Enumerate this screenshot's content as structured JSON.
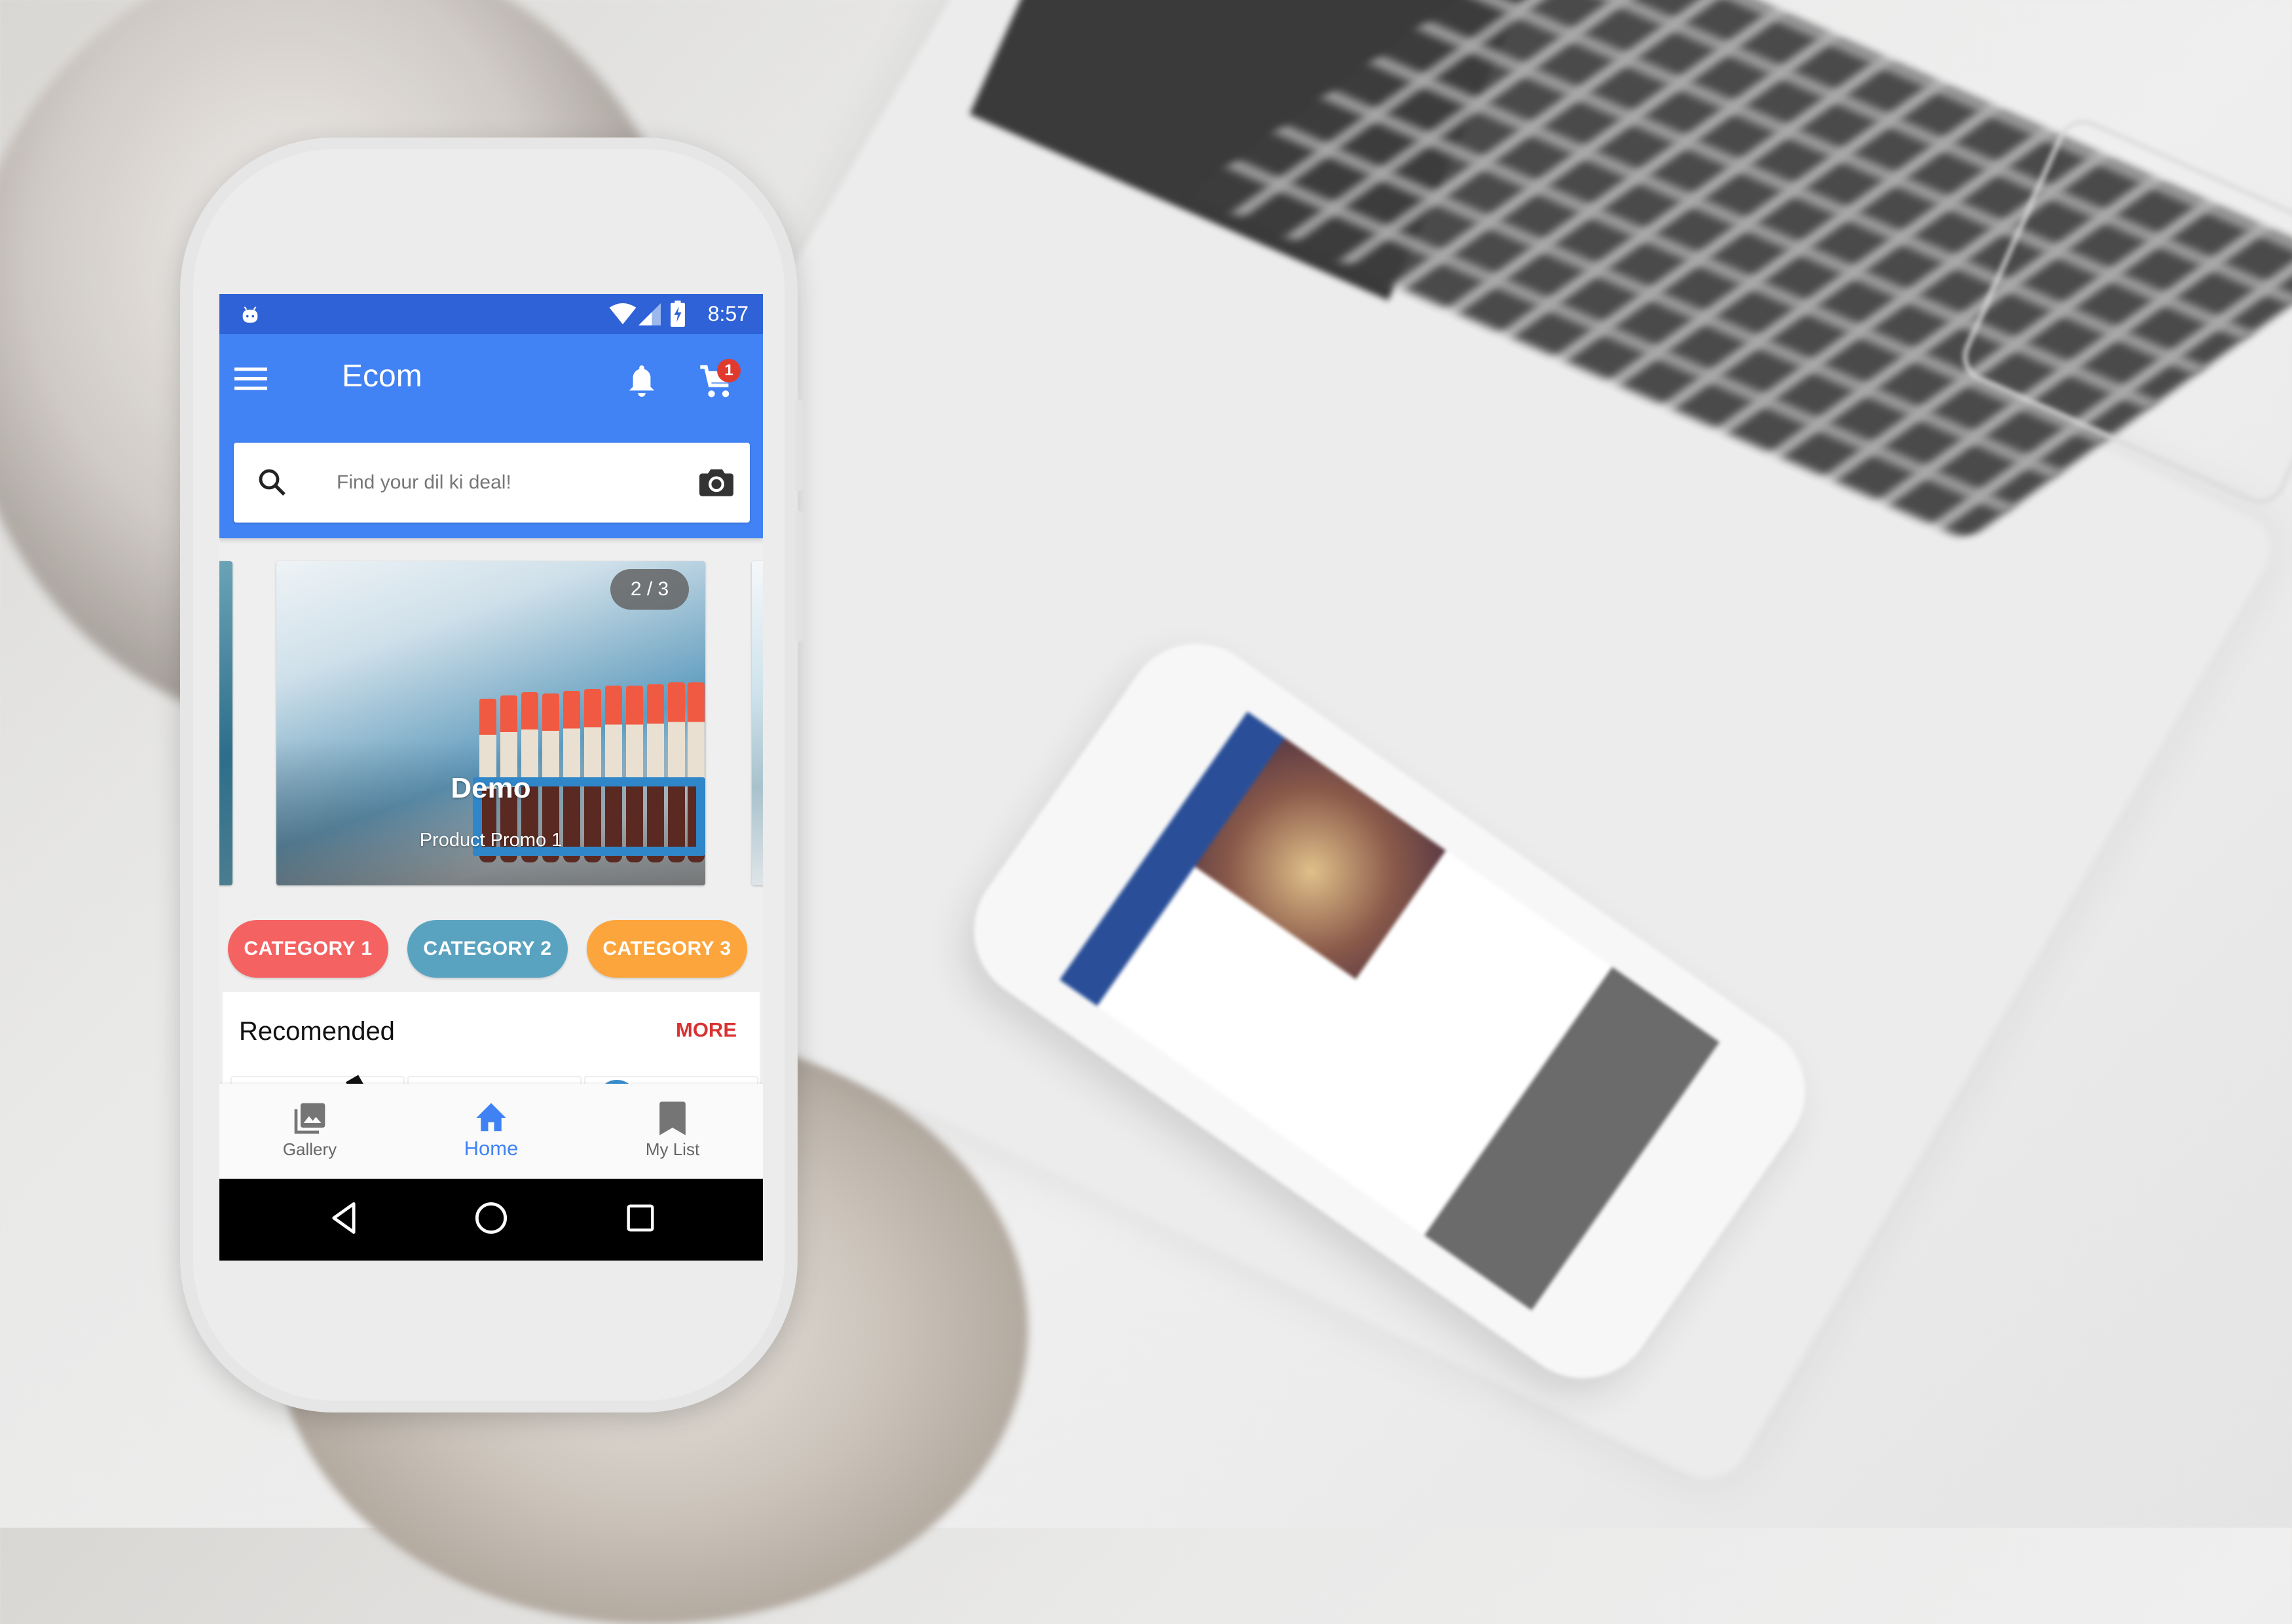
{
  "status_bar": {
    "time": "8:57",
    "icons": [
      "android-debug-icon",
      "wifi-icon",
      "signal-icon",
      "battery-charging-icon"
    ]
  },
  "app_bar": {
    "title": "Ecom",
    "menu_icon": "hamburger-menu-icon",
    "notification_icon": "bell-icon",
    "cart_icon": "shopping-cart-icon",
    "cart_badge": "1"
  },
  "search": {
    "placeholder": "Find your dil ki deal!",
    "value": "",
    "left_icon": "search-icon",
    "right_icon": "camera-icon"
  },
  "carousel": {
    "pager": "2 / 3",
    "current": 2,
    "total": 3,
    "slide_title": "Demo",
    "slide_subtitle": "Product Promo 1"
  },
  "categories": [
    {
      "label": "CATEGORY 1",
      "color": "#F46262"
    },
    {
      "label": "CATEGORY 2",
      "color": "#5AA3C0"
    },
    {
      "label": "CATEGORY 3",
      "color": "#FDA53D"
    }
  ],
  "recommended": {
    "title": "Recomended",
    "more_label": "MORE"
  },
  "bottom_nav": {
    "items": [
      {
        "label": "Gallery",
        "icon": "gallery-icon",
        "active": false
      },
      {
        "label": "Home",
        "icon": "home-icon",
        "active": true
      },
      {
        "label": "My List",
        "icon": "bookmark-icon",
        "active": false
      }
    ]
  },
  "system_nav": {
    "back_icon": "back-icon",
    "home_icon": "home-circle-icon",
    "recents_icon": "recents-icon"
  },
  "colors": {
    "status_bar": "#2F62D6",
    "primary": "#4182F4",
    "accent_red": "#D83232",
    "badge": "#E03A2F"
  }
}
